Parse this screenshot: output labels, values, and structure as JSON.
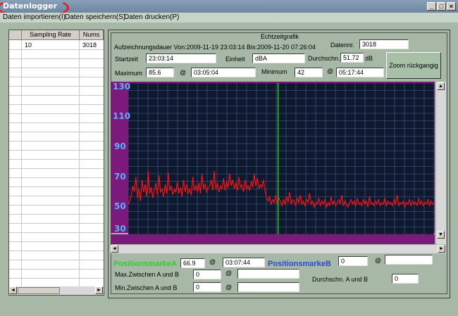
{
  "window": {
    "title": "Datenlogger"
  },
  "menu": [
    "Daten importieren(I)",
    "Daten speichern(S)",
    "Daten drucken(P)"
  ],
  "table": {
    "headers": [
      "Sampling Rate",
      "Nums"
    ],
    "rows": [
      [
        "10",
        "3018"
      ]
    ]
  },
  "panel": {
    "title": "Echtzeitgrafik",
    "duration_text": "Aufzeichnungsdauer Von:2009-11-19 23:03:14 Bis:2009-11-20 07:26:04",
    "datennr_label": "Datennr.",
    "datennr_value": "3018",
    "startzeit_label": "Startzeit",
    "startzeit_value": "23:03:14",
    "einheit_label": "Einheit",
    "einheit_value": "dBA",
    "durchschn_label": "Durchschn.",
    "durchschn_value": "51.72",
    "durchschn_unit": "dB",
    "maximum_label": "Maximum",
    "maximum_value": "85.6",
    "max_at": "@",
    "maximum_time": "03:05:04",
    "minimum_label": "Minimum",
    "minimum_value": "42",
    "min_at": "@",
    "minimum_time": "05:17:44",
    "zoom_label": "Zoom rückgangig"
  },
  "bottom": {
    "posA_label": "PositionsmarkeA",
    "posA_value": "66.9",
    "posA_at": "@",
    "posA_time": "03:07:44",
    "posB_label": "PositionsmarkeB",
    "posB_value": "0",
    "posB_at": "@",
    "posB_time": "",
    "max_ab_label": "Max.Zwischen A und B",
    "max_ab_value": "0",
    "max_ab_at": "@",
    "max_ab_time": "",
    "min_ab_label": "Min.Zwischen A und B",
    "min_ab_value": "0",
    "min_ab_at": "@",
    "min_ab_time": "",
    "avg_ab_label": "Durchschn. A und B",
    "avg_ab_value": "0"
  },
  "chart_data": {
    "type": "line",
    "ylim": [
      30,
      130
    ],
    "yticks": [
      "130",
      "110",
      "90",
      "70",
      "50",
      "30"
    ],
    "grid": true,
    "cursor_sample_fraction": 0.49,
    "series_color": "#ff1010",
    "cursor_color": "#20d020",
    "grid_color": "#3a6a8a",
    "background_color": "#101830",
    "series": [
      {
        "values": [
          50,
          52,
          56,
          62,
          58,
          68,
          54,
          60,
          52,
          66,
          58,
          63,
          55,
          72,
          57,
          61,
          54,
          59,
          64,
          56,
          69,
          58,
          60,
          55,
          63,
          57,
          71,
          59,
          62,
          56,
          60,
          58,
          65,
          57,
          61,
          55,
          66,
          58,
          63,
          57,
          60,
          56,
          68,
          59,
          62,
          58,
          64,
          57,
          70,
          60,
          63,
          58,
          61,
          62,
          66,
          59,
          72,
          60,
          64,
          58,
          62,
          60,
          67,
          59,
          65,
          61,
          70,
          62,
          66,
          60,
          64,
          59,
          68,
          61,
          63,
          58,
          66,
          60,
          62,
          59,
          65,
          61,
          70,
          62,
          67,
          60,
          63,
          61,
          66,
          59,
          54,
          52,
          55,
          50,
          53,
          51,
          56,
          50,
          54,
          52,
          49,
          53,
          50,
          55,
          51,
          58,
          50,
          53,
          52,
          49,
          54,
          51,
          56,
          50,
          52,
          49,
          53,
          51,
          57,
          50,
          52,
          48,
          51,
          50,
          54,
          49,
          52,
          50,
          53,
          48,
          51,
          49,
          55,
          50,
          52,
          49,
          51,
          53,
          50,
          56,
          49,
          52,
          50,
          48,
          51,
          53,
          50,
          52,
          49,
          54,
          50,
          51,
          49,
          53,
          50,
          52,
          48,
          55,
          50,
          51,
          49,
          52,
          50,
          53,
          49,
          51,
          50,
          54,
          49,
          52,
          50,
          51,
          49,
          53,
          50,
          56,
          49,
          51,
          50,
          52,
          48,
          51,
          50,
          53,
          49,
          52,
          50,
          51,
          49,
          54,
          50,
          52,
          49,
          51,
          50,
          53,
          49,
          52,
          50,
          51
        ]
      }
    ]
  }
}
